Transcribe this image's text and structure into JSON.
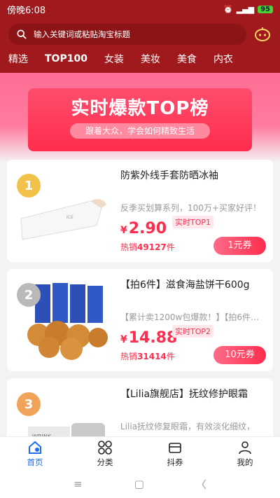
{
  "status_bar": {
    "time": "傍晚6:08",
    "battery": "95"
  },
  "search": {
    "placeholder": "输入关键词或粘贴淘宝标题"
  },
  "nav_tabs": [
    "精选",
    "TOP100",
    "女装",
    "美妆",
    "美食",
    "内衣"
  ],
  "banner": {
    "title": "实时爆款TOP榜",
    "subtitle": "跟着大众，学会如何精致生活"
  },
  "products": [
    {
      "rank": "1",
      "title": "防紫外线手套防晒冰袖",
      "desc": "反季买划算系列，100万+买家好评！",
      "currency": "¥",
      "price": "2.90",
      "badge": "实时TOP1",
      "sold_label": "热销",
      "sold_num": "49127",
      "sold_unit": "件",
      "coupon": "1元券"
    },
    {
      "rank": "2",
      "title": "【拍6件】滋食海盐饼干600g",
      "desc": "【累计卖1200w包爆款！】【拍6件…",
      "currency": "¥",
      "price": "14.88",
      "badge": "实时TOP2",
      "sold_label": "热销",
      "sold_num": "31414",
      "sold_unit": "件",
      "coupon": "10元券"
    },
    {
      "rank": "3",
      "title": "【Lilia旗舰店】抚纹修护眼霜",
      "desc": "Lilia抚纹修复眼霜，有效淡化细纹，",
      "currency": "¥",
      "price": "",
      "badge": "",
      "sold_label": "",
      "sold_num": "",
      "sold_unit": "",
      "coupon": ""
    }
  ],
  "bottom_nav": [
    {
      "label": "首页",
      "icon": "home-icon",
      "active": true
    },
    {
      "label": "分类",
      "icon": "grid-icon",
      "active": false
    },
    {
      "label": "抖券",
      "icon": "ticket-icon",
      "active": false
    },
    {
      "label": "我的",
      "icon": "person-icon",
      "active": false
    }
  ],
  "colors": {
    "header": "#a0191c",
    "accent": "#ff2d4d",
    "active_tab": "#1e6ef0"
  }
}
